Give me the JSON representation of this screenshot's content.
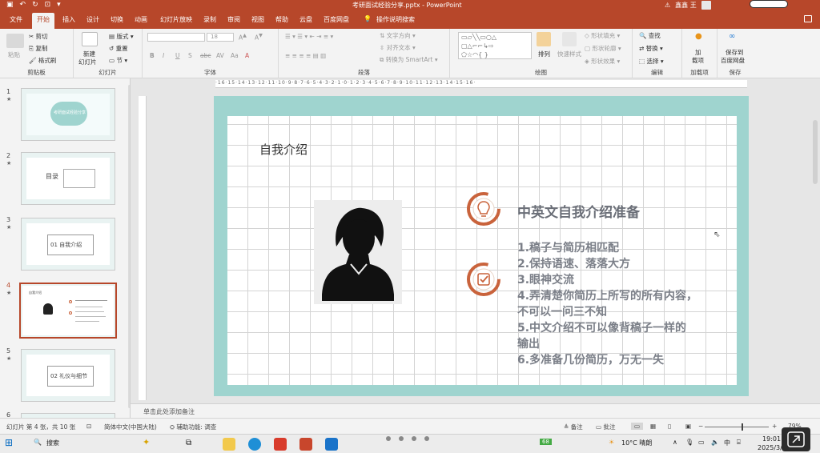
{
  "titlebar": {
    "document_title": "考研面试经验分享.pptx  -  PowerPoint",
    "warning": "⚠",
    "user_name": "鑫鑫 王"
  },
  "tabs": [
    "文件",
    "开始",
    "插入",
    "设计",
    "切换",
    "动画",
    "幻灯片放映",
    "录制",
    "审阅",
    "视图",
    "帮助",
    "云盘",
    "百度网盘",
    "操作说明搜索"
  ],
  "ribbon": {
    "clipboard": {
      "label": "剪贴板",
      "paste": "粘贴",
      "cut": "剪切",
      "copy": "复制",
      "format_painter": "格式刷"
    },
    "slides": {
      "label": "幻灯片",
      "new_slide": "新建",
      "new_slide2": "幻灯片",
      "layout": "版式",
      "reset": "重置",
      "section": "节"
    },
    "font": {
      "label": "字体",
      "font_size": "18",
      "bold": "B",
      "italic": "I",
      "underline": "U",
      "shadow": "S",
      "strike": "abc",
      "spacing": "AV",
      "case": "Aa"
    },
    "paragraph": {
      "label": "段落",
      "text_direction": "文字方向",
      "align_text": "对齐文本",
      "smartart": "转换为 SmartArt"
    },
    "drawing": {
      "label": "绘图",
      "arrange": "排列",
      "quick_styles": "快速样式",
      "shape_fill": "形状填充",
      "shape_outline": "形状轮廓",
      "shape_effects": "形状效果"
    },
    "editing": {
      "label": "编辑",
      "find": "查找",
      "replace": "替换",
      "select": "选择"
    },
    "addins": {
      "label": "加载项",
      "addin": "加",
      "addin2": "载项"
    },
    "save": {
      "label": "保存",
      "save_to": "保存到",
      "baidu": "百度网盘"
    }
  },
  "thumbnails": [
    {
      "num": "1",
      "text": "考研面试经验分享"
    },
    {
      "num": "2",
      "text": "目录"
    },
    {
      "num": "3",
      "text": "01 自我介绍"
    },
    {
      "num": "4",
      "text": "自我介绍"
    },
    {
      "num": "5",
      "text": "02 礼仪与细节"
    },
    {
      "num": "6",
      "text": ""
    }
  ],
  "ruler": {
    "horizontal": "·16·15·14·13·12·11·10·9·8·7·6·5·4·3·2·1·0·1·2·3·4·5·6·7·8·9·10·11·12·13·14·15·16·"
  },
  "slide": {
    "title": "自我介绍",
    "heading": "中英文自我介绍准备",
    "items": [
      "1.稿子与简历相匹配",
      "2.保持语速、落落大方",
      "3.眼神交流",
      "4.弄清楚你简历上所写的所有内容，",
      "不可以一问三不知",
      "5.中文介绍不可以像背稿子一样的",
      "输出",
      "6.多准备几份简历，万无一失"
    ],
    "accent_color": "#c9633c",
    "border_color": "#9fd4cf"
  },
  "notes": {
    "placeholder": "单击此处添加备注"
  },
  "statusbar": {
    "slide_info": "幻灯片 第 4 张，共 10 张",
    "language": "简体中文(中国大陆)",
    "accessibility": "辅助功能: 调查",
    "notes": "备注",
    "comments": "批注",
    "zoom": "79%"
  },
  "taskbar": {
    "search": "搜索",
    "battery": "68",
    "weather": "10°C 晴朗",
    "ime": "中",
    "time": "19:01",
    "date": "2025/3/"
  }
}
